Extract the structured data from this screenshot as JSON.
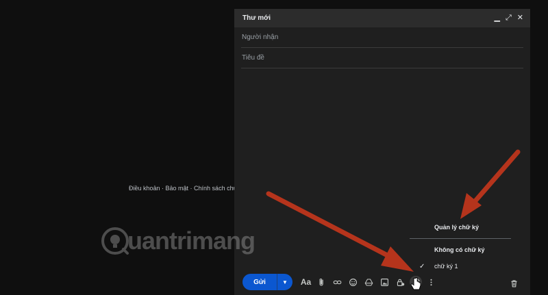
{
  "background": {
    "footer_links": "Điều khoản · Bảo mật · Chính sách chươ"
  },
  "compose": {
    "title": "Thư mới",
    "header_icons": [
      "minimize-icon",
      "expand-icon",
      "close-icon"
    ],
    "recipients_placeholder": "Người nhận",
    "subject_placeholder": "Tiêu đề",
    "send_label": "Gửi",
    "toolbar_icons": [
      "formatting-icon",
      "attach-icon",
      "link-icon",
      "emoji-icon",
      "drive-icon",
      "photo-icon",
      "confidential-lock-icon",
      "signature-pen-icon",
      "more-options-icon",
      "trash-icon"
    ],
    "formatting_label": "Aa"
  },
  "signature_menu": {
    "manage_label": "Quản lý chữ ký",
    "no_signature_label": "Không có chữ ký",
    "signature_1_label": "chữ ký 1",
    "selected": "chữ ký 1"
  },
  "watermark": {
    "text": "uantrimang"
  },
  "colors": {
    "accent": "#0b57d0",
    "arrow": "#b5341c",
    "panel": "#1f1f1f",
    "header": "#2c2c2c"
  }
}
